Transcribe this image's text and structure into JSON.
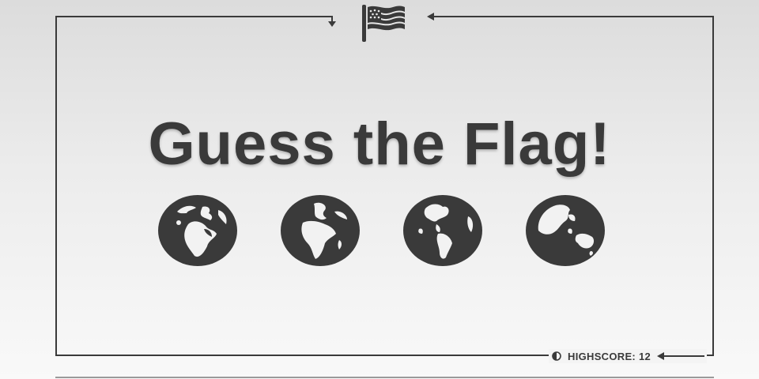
{
  "header": {
    "icon": "flag-icon"
  },
  "title": "Guess the Flag!",
  "globes": [
    {
      "name": "globe-europe-africa-icon"
    },
    {
      "name": "globe-africa-icon"
    },
    {
      "name": "globe-americas-icon"
    },
    {
      "name": "globe-asia-australia-icon"
    }
  ],
  "highscore": {
    "label": "HIGHSCORE: 12",
    "icon": "half-circle-icon"
  },
  "colors": {
    "ink": "#3a3a3a",
    "background_top": "#dcdcdc",
    "background_bottom": "#f9f9f9"
  }
}
